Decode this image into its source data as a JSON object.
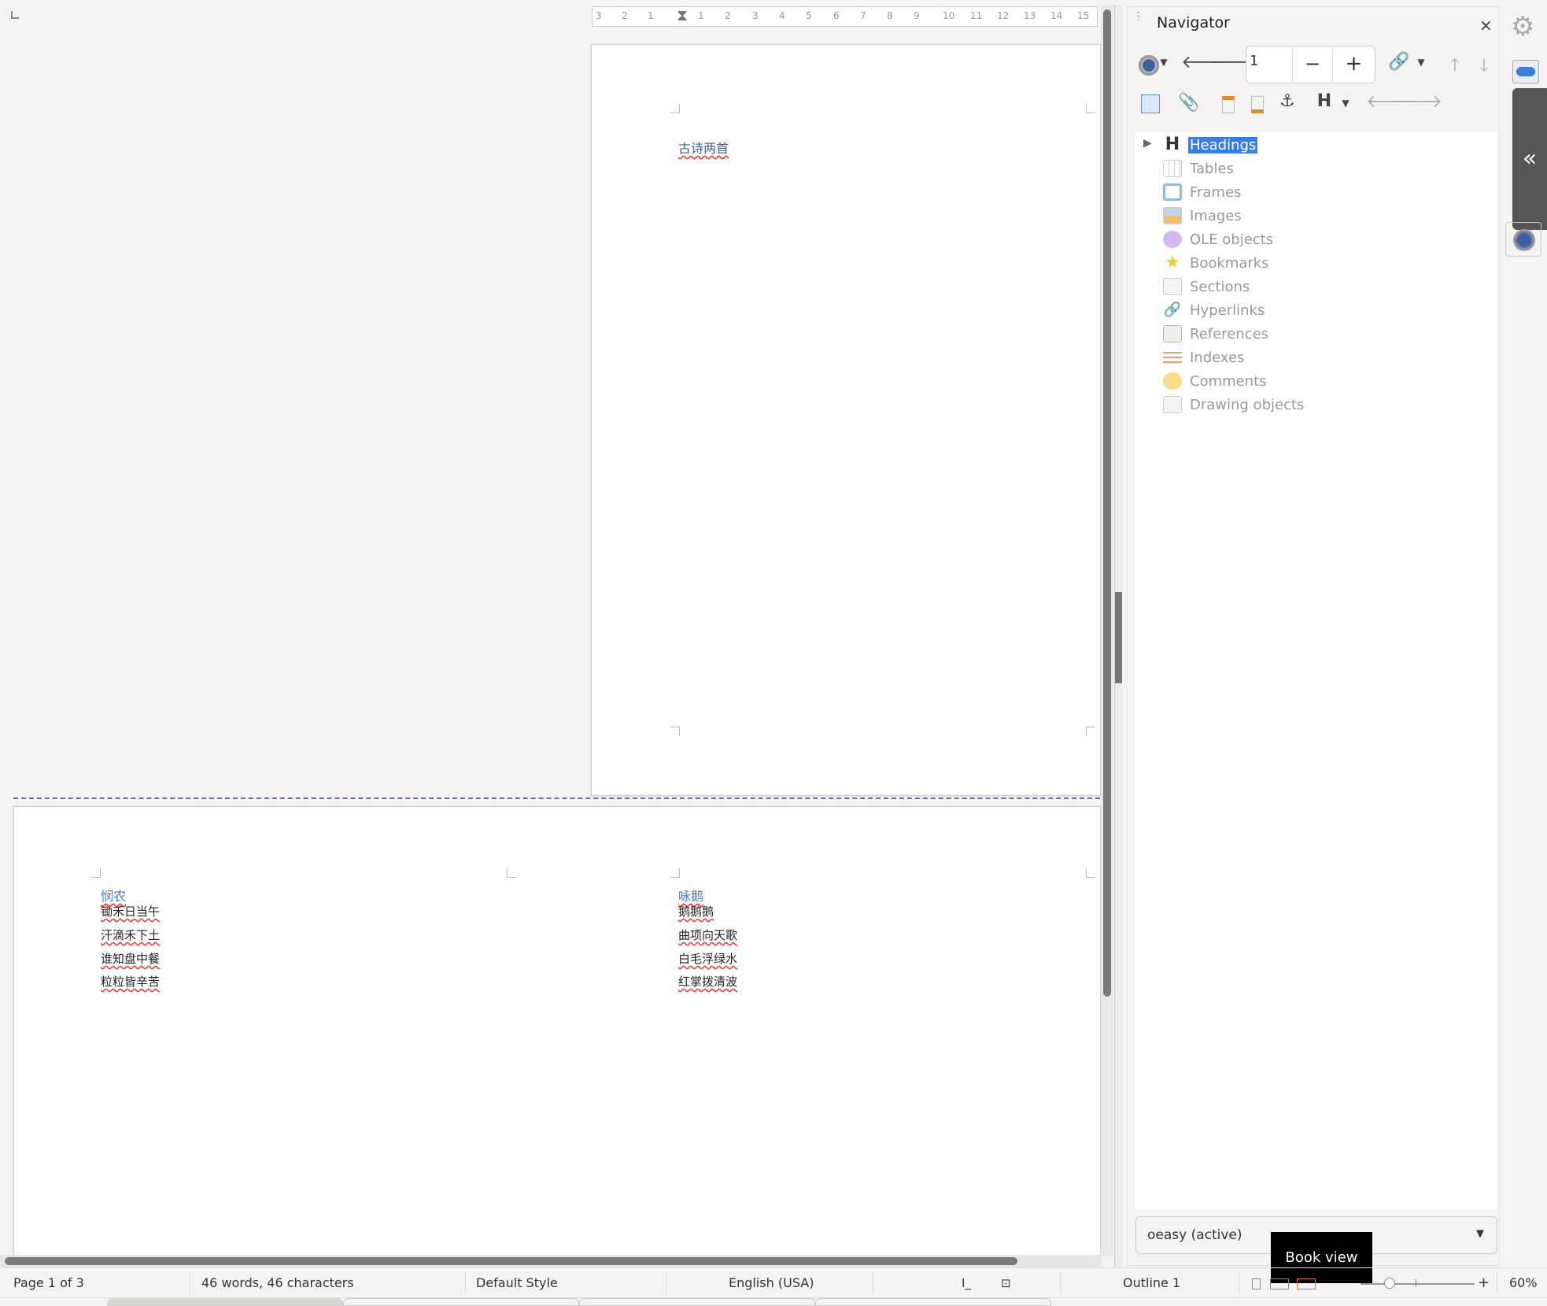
{
  "ruler": {
    "labels": [
      "3",
      "2",
      "1",
      "1",
      "2",
      "3",
      "4",
      "5",
      "6",
      "7",
      "8",
      "9",
      "10",
      "11",
      "12",
      "13",
      "14",
      "15"
    ]
  },
  "document": {
    "page1": {
      "title": "古诗两首"
    },
    "page2": {
      "poem1": {
        "title": "悯农",
        "lines": [
          "锄禾日当午",
          "汗滴禾下土",
          "谁知盘中餐",
          "粒粒皆辛苦"
        ]
      },
      "poem2": {
        "title": "咏鹅",
        "lines": [
          "鹅鹅鹅",
          "曲项向天歌",
          "白毛浮绿水",
          "红掌拨清波"
        ]
      }
    }
  },
  "navigator": {
    "title": "Navigator",
    "page_number": "1",
    "close": "×",
    "tree": [
      {
        "label": "Headings",
        "icon": "heading-icon",
        "selected": true
      },
      {
        "label": "Tables",
        "icon": "table-icon"
      },
      {
        "label": "Frames",
        "icon": "frame-icon"
      },
      {
        "label": "Images",
        "icon": "image-icon"
      },
      {
        "label": "OLE objects",
        "icon": "ole-icon"
      },
      {
        "label": "Bookmarks",
        "icon": "star-icon"
      },
      {
        "label": "Sections",
        "icon": "section-icon"
      },
      {
        "label": "Hyperlinks",
        "icon": "link-icon"
      },
      {
        "label": "References",
        "icon": "reference-icon"
      },
      {
        "label": "Indexes",
        "icon": "index-icon"
      },
      {
        "label": "Comments",
        "icon": "comment-icon"
      },
      {
        "label": "Drawing objects",
        "icon": "drawing-icon"
      }
    ],
    "document_select": "oeasy (active)"
  },
  "tooltip": "Book view",
  "statusbar": {
    "page": "Page 1 of 3",
    "words": "46 words, 46 characters",
    "style": "Default Style",
    "language": "English (USA)",
    "outline": "Outline 1",
    "zoom": "60%",
    "zoom_percent": 60
  },
  "colors": {
    "selection": "#3c7de0",
    "heading": "#4a78c4",
    "spell": "#e33333"
  }
}
